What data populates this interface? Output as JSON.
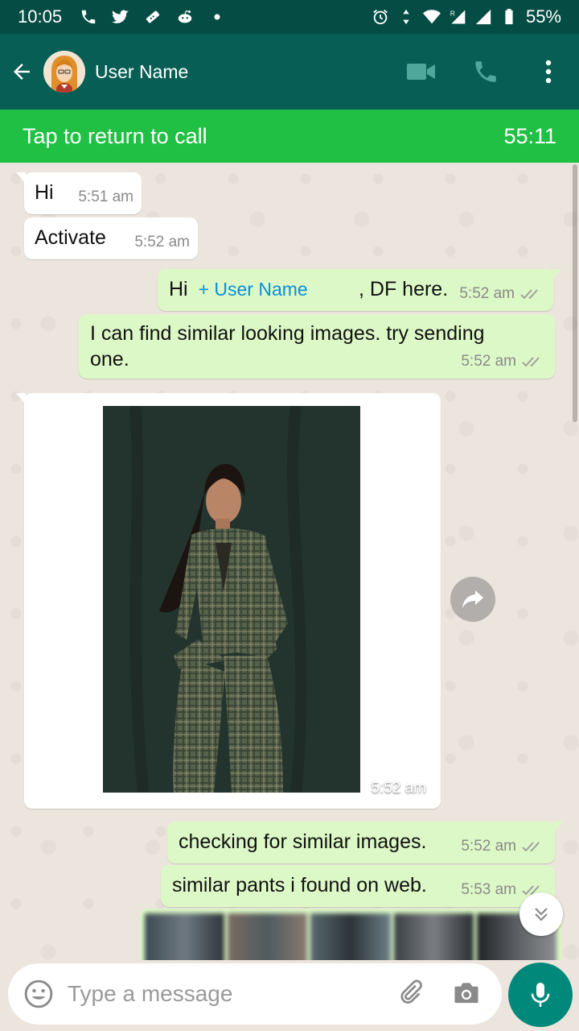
{
  "status_bar": {
    "time": "10:05",
    "battery": "55%",
    "icons": [
      "phone-icon",
      "twitter-icon",
      "ticket-icon",
      "reddit-icon",
      "dot-icon",
      "alarm-icon",
      "data-arrows-icon",
      "wifi-icon",
      "signal-roaming-icon",
      "signal-icon",
      "battery-icon"
    ]
  },
  "header": {
    "title": "User Name",
    "icons": [
      "back-arrow-icon",
      "video-call-icon",
      "voice-call-icon",
      "more-menu-icon"
    ]
  },
  "call_banner": {
    "label": "Tap to return to call",
    "duration": "55:11"
  },
  "messages": [
    {
      "id": "m1",
      "direction": "incoming",
      "text": "Hi",
      "time": "5:51 am"
    },
    {
      "id": "m2",
      "direction": "incoming",
      "text": "Activate",
      "time": "5:52 am"
    },
    {
      "id": "m3",
      "direction": "outgoing",
      "prefix": "Hi",
      "mention": "+ User Name",
      "suffix": ", DF here.",
      "time": "5:52 am",
      "status": "delivered"
    },
    {
      "id": "m4",
      "direction": "outgoing",
      "text": "I can find similar looking images. try sending one.",
      "time": "5:52 am",
      "status": "delivered"
    },
    {
      "id": "m5",
      "direction": "incoming",
      "type": "image",
      "time": "5:52 am"
    },
    {
      "id": "m6",
      "direction": "outgoing",
      "text": "checking for similar images.",
      "time": "5:52 am",
      "status": "delivered"
    },
    {
      "id": "m7",
      "direction": "outgoing",
      "text": "similar pants i found on web.",
      "time": "5:53 am",
      "status": "delivered"
    },
    {
      "id": "m8",
      "direction": "outgoing",
      "type": "image-gallery"
    }
  ],
  "composer": {
    "placeholder": "Type a message",
    "icons": [
      "emoji-icon",
      "attach-icon",
      "camera-icon",
      "mic-icon"
    ]
  },
  "colors": {
    "header": "#075e54",
    "status_bar": "#054d44",
    "call_banner": "#20c044",
    "outgoing_bubble": "#dcf8c6",
    "incoming_bubble": "#ffffff",
    "mention": "#0b8ed8",
    "mic_button": "#00897b"
  }
}
